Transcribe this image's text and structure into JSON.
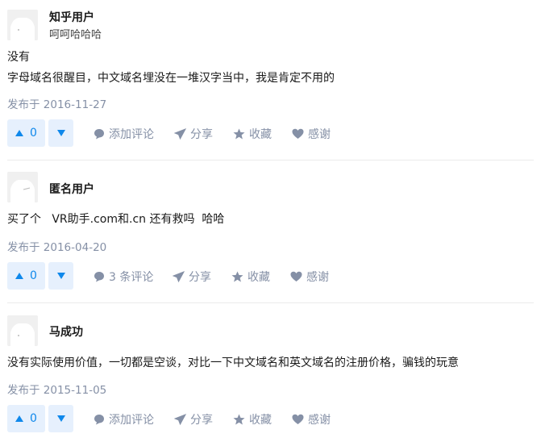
{
  "answers": [
    {
      "author": "知乎用户",
      "bio": "呵呵哈哈哈",
      "lines": [
        "没有",
        "字母域名很醒目，中文域名埋没在一堆汉字当中，我是肯定不用的"
      ],
      "date": "发布于 2016-11-27",
      "votes": "0",
      "comment_label": "添加评论",
      "share_label": "分享",
      "collect_label": "收藏",
      "thanks_label": "感谢"
    },
    {
      "author": "匿名用户",
      "bio": "",
      "lines": [
        "买了个   VR助手.com和.cn 还有救吗  哈哈"
      ],
      "date": "发布于 2016-04-20",
      "votes": "0",
      "comment_label": "3 条评论",
      "share_label": "分享",
      "collect_label": "收藏",
      "thanks_label": "感谢"
    },
    {
      "author": "马成功",
      "bio": "",
      "lines": [
        "没有实际使用价值，一切都是空谈，对比一下中文域名和英文域名的注册价格，骗钱的玩意"
      ],
      "date": "发布于 2015-11-05",
      "votes": "0",
      "comment_label": "添加评论",
      "share_label": "分享",
      "collect_label": "收藏",
      "thanks_label": "感谢"
    }
  ],
  "colors": {
    "accent": "#0f88eb",
    "vote_bg": "#e6f0fd",
    "meta_gray": "#8590a6",
    "divider": "#ebebeb"
  }
}
